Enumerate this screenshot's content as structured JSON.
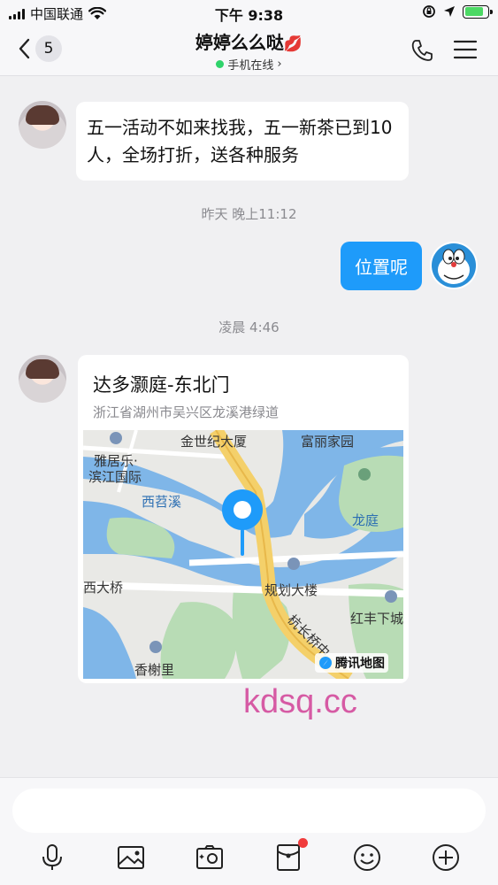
{
  "status_bar": {
    "carrier": "中国联通",
    "time": "下午 9:38",
    "battery_level": 0.85
  },
  "header": {
    "back_count": "5",
    "contact_name": "婷婷么么哒",
    "contact_emoji": "💋",
    "online_status": "手机在线",
    "online_chevron": "›"
  },
  "messages": {
    "msg1_text": "五一活动不如来找我，五一新茶已到10人，全场打折，送各种服务",
    "time1": "昨天 晚上11:12",
    "msg2_text": "位置呢",
    "time2": "凌晨 4:46",
    "location": {
      "name": "达多灏庭-东北门",
      "address": "浙江省湖州市吴兴区龙溪港绿道",
      "map_labels": {
        "jinshiji": "金世纪大厦",
        "fuli": "富丽家园",
        "yajule1": "雅居乐·",
        "yajule2": "滨江国际",
        "xitiaoxi": "西苕溪",
        "longting": "龙庭",
        "xidaqiao": "西大桥",
        "guihua": "规划大楼",
        "hongfeng": "红丰下城",
        "hangchang": "杭长桥中",
        "xiangxieli": "香榭里"
      },
      "map_brand": "腾讯地图"
    }
  },
  "watermark": "kdsq.cc",
  "input": {
    "placeholder": ""
  },
  "colors": {
    "accent_blue": "#1e9bfa",
    "online_green": "#2fd36b",
    "watermark_pink": "#d65aa4"
  },
  "icons": {
    "status": [
      "signal-icon",
      "wifi-icon",
      "rotation-lock-icon",
      "location-arrow-icon",
      "battery-icon"
    ],
    "toolbar": [
      "microphone-icon",
      "image-icon",
      "camera-icon",
      "red-packet-icon",
      "emoji-icon",
      "plus-icon"
    ]
  }
}
